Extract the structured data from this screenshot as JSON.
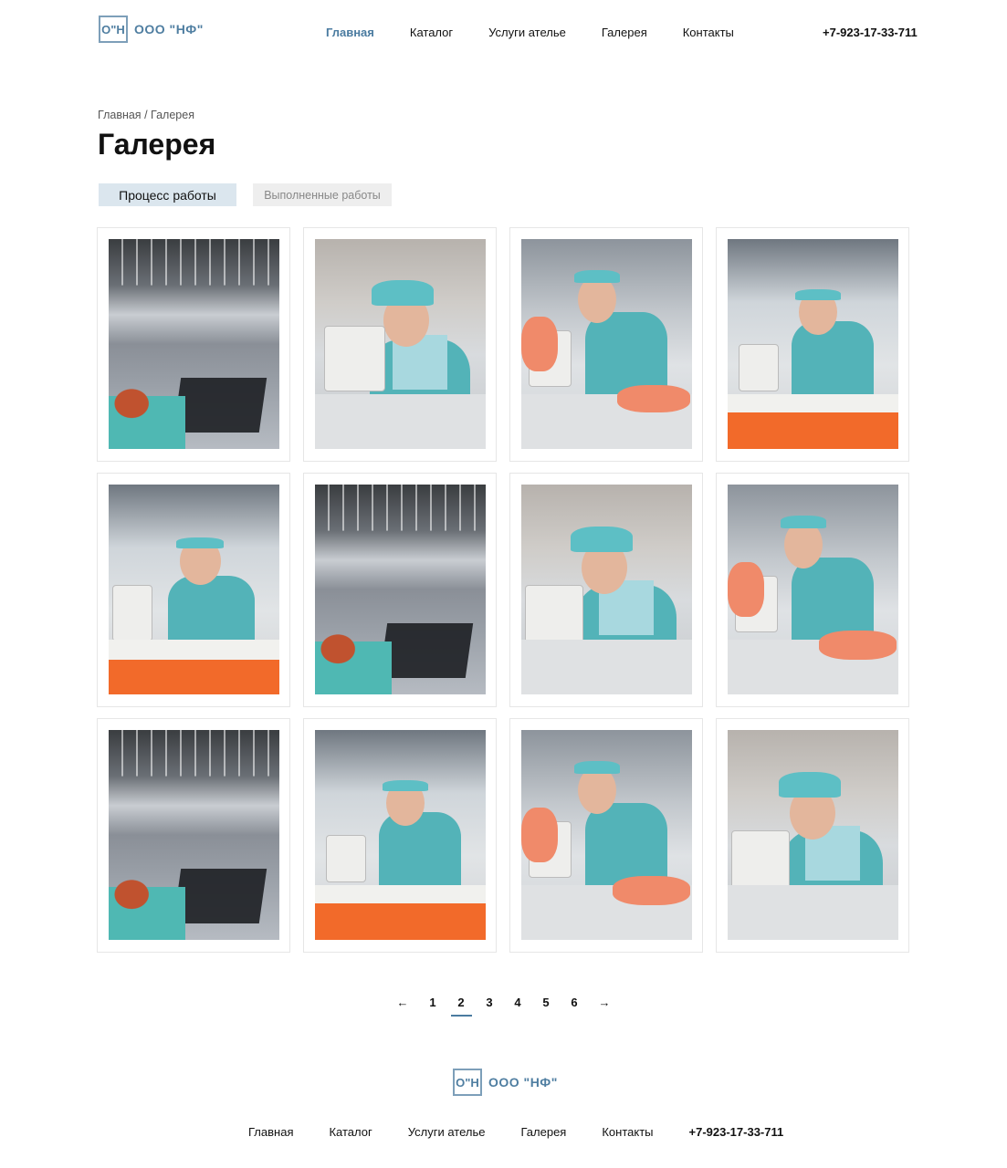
{
  "brand": {
    "logo_mark": "О\"Н",
    "name": "ООО \"НФ\""
  },
  "header": {
    "nav": [
      {
        "label": "Главная",
        "active": true
      },
      {
        "label": "Каталог",
        "active": false
      },
      {
        "label": "Услуги ателье",
        "active": false
      },
      {
        "label": "Галерея",
        "active": false
      },
      {
        "label": "Контакты",
        "active": false
      }
    ],
    "phone": "+7-923-17-33-711"
  },
  "breadcrumb": {
    "home": "Главная",
    "separator": "/",
    "current": "Галерея"
  },
  "page_title": "Галерея",
  "tabs": [
    {
      "label": "Процесс работы",
      "active": true
    },
    {
      "label": "Выполненные работы",
      "active": false
    }
  ],
  "gallery": {
    "photos": [
      {
        "scene": "sewing-hall"
      },
      {
        "scene": "worker-scarf-machine"
      },
      {
        "scene": "worker-orange-fabric"
      },
      {
        "scene": "worker-orange-table"
      },
      {
        "scene": "worker-orange-table"
      },
      {
        "scene": "sewing-hall"
      },
      {
        "scene": "worker-scarf-machine"
      },
      {
        "scene": "worker-orange-fabric"
      },
      {
        "scene": "sewing-hall"
      },
      {
        "scene": "worker-orange-table"
      },
      {
        "scene": "worker-orange-fabric"
      },
      {
        "scene": "worker-scarf-machine"
      }
    ]
  },
  "pagination": {
    "prev_icon": "arrow-left-icon",
    "prev_glyph": "←",
    "pages": [
      "1",
      "2",
      "3",
      "4",
      "5",
      "6"
    ],
    "current_page": "2",
    "next_icon": "arrow-right-icon",
    "next_glyph": "→"
  },
  "footer": {
    "nav": [
      {
        "label": "Главная"
      },
      {
        "label": "Каталог"
      },
      {
        "label": "Услуги ателье"
      },
      {
        "label": "Галерея"
      },
      {
        "label": "Контакты"
      }
    ],
    "phone": "+7-923-17-33-711"
  },
  "colors": {
    "accent": "#4a7ba0",
    "logo": "#4f7ea1",
    "active_tab_bg": "#dbe6ee",
    "inactive_tab_bg": "#eeeeee"
  }
}
